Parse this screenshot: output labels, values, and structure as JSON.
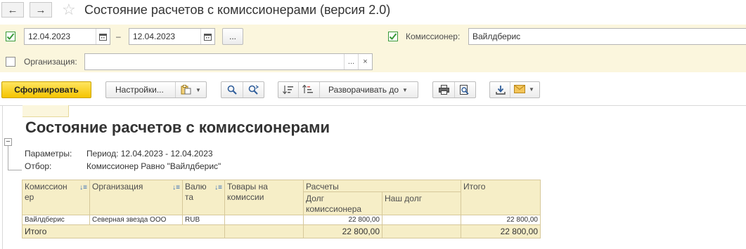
{
  "window": {
    "title": "Состояние расчетов с комиссионерами (версия 2.0)",
    "back_icon": "←",
    "forward_icon": "→",
    "favorite_icon": "☆"
  },
  "settings": {
    "period_from": "12.04.2023",
    "period_dash": "–",
    "period_to": "12.04.2023",
    "period_more": "...",
    "commissioner_label": "Комиссионер:",
    "commissioner_value": "Вайлдберис",
    "organization_label": "Организация:",
    "organization_value": "",
    "select_more": "...",
    "clear_icon": "×"
  },
  "toolbar": {
    "generate": "Сформировать",
    "settings": "Настройки...",
    "expand_to": "Разворачивать до"
  },
  "report": {
    "title": "Состояние расчетов с комиссионерами",
    "params_label": "Параметры:",
    "params_value": "Период: 12.04.2023 - 12.04.2023",
    "filter_label": "Отбор:",
    "filter_value": "Комиссионер Равно \"Вайлдберис\"",
    "collapse_icon": "−"
  },
  "table": {
    "headers": {
      "commissioner": "Комиссион ер",
      "organization": "Организация",
      "currency": "Валю та",
      "goods": "Товары на комиссии",
      "settlements": "Расчеты",
      "commissioner_debt": "Долг комиссионера",
      "our_debt": "Наш долг",
      "total": "Итого"
    },
    "rows": [
      {
        "commissioner": "Вайлдберис",
        "organization": "Северная звезда ООО",
        "currency": "RUB",
        "goods": "",
        "commissioner_debt": "22 800,00",
        "our_debt": "",
        "total": "22 800,00"
      }
    ],
    "totals": {
      "label": "Итого",
      "commissioner_debt": "22 800,00",
      "our_debt": "",
      "total": "22 800,00"
    }
  },
  "colors": {
    "accent": "#f5c400",
    "panel_bg": "#fbf6dd",
    "header_bg": "#f6eec7",
    "check": "#3a9a3a"
  }
}
